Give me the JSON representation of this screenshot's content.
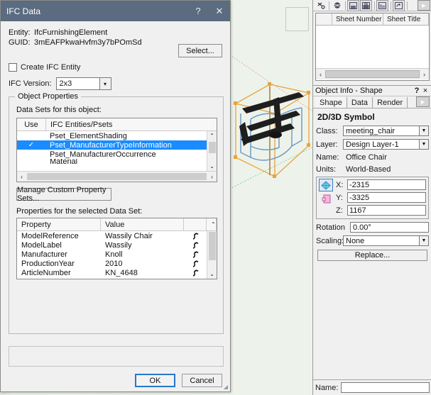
{
  "viewport": {
    "name": "3d-model-viewport",
    "model_label": "Wassily Chair 3D wireframe model"
  },
  "right_dock": {
    "toolbar": {
      "buttons": [
        {
          "name": "snap-icon",
          "glyph": "⁂"
        },
        {
          "name": "render-icon",
          "glyph": "✻"
        },
        {
          "name": "save-sheet-icon",
          "glyph": "▣"
        },
        {
          "name": "publish-icon",
          "glyph": "▤"
        },
        {
          "name": "open-folder-icon",
          "glyph": "▥"
        },
        {
          "name": "undo-icon",
          "glyph": "↶"
        }
      ],
      "overflow_glyph": "▶"
    },
    "sheet_list": {
      "columns": [
        "Sheet Number",
        "Sheet Title"
      ],
      "rows": [],
      "scroll_left_glyph": "‹",
      "scroll_right_glyph": "›"
    },
    "object_info": {
      "title": "Object Info - Shape",
      "help_glyph": "?",
      "close_glyph": "×",
      "tabs": [
        {
          "label": "Shape",
          "active": true
        },
        {
          "label": "Data",
          "active": false
        },
        {
          "label": "Render",
          "active": false
        }
      ],
      "tabs_more_glyph": "▶",
      "section_title": "2D/3D Symbol",
      "fields": {
        "class_label": "Class:",
        "class_value": "meeting_chair",
        "layer_label": "Layer:",
        "layer_value": "Design Layer-1",
        "name_label": "Name:",
        "name_value": "Office Chair",
        "units_label": "Units:",
        "units_value": "World-Based",
        "x_label": "X:",
        "x_value": "-2315",
        "y_label": "Y:",
        "y_value": "-3325",
        "z_label": "Z:",
        "z_value": "1167",
        "rotation_label": "Rotation",
        "rotation_value": "0.00°",
        "scaling_label": "Scaling:",
        "scaling_value": "None"
      },
      "coord_icons": [
        {
          "name": "3d-locus-icon",
          "selected": true,
          "color": "#2f9fd0"
        },
        {
          "name": "2d-plane-icon",
          "selected": false,
          "color": "#e06ab0"
        }
      ],
      "replace_button": "Replace...",
      "dropdown_glyph": "▼",
      "bottom": {
        "name_label": "Name:",
        "name_value": ""
      }
    }
  },
  "dialog": {
    "title": "IFC Data",
    "help_glyph": "?",
    "close_glyph": "✕",
    "entity_key": "Entity:",
    "entity_value": "IfcFurnishingElement",
    "guid_key": "GUID:",
    "guid_value": "3mEAFPkwaHvfm3y7bPOmSd",
    "select_button": "Select...",
    "create_ifc_entity_label": "Create IFC Entity",
    "create_ifc_entity_checked": false,
    "ifc_version_label": "IFC Version:",
    "ifc_version_value": "2x3",
    "group_legend": "Object Properties",
    "datasets_label": "Data Sets for this object:",
    "datasets_columns": [
      "Use",
      "IFC Entities/Psets"
    ],
    "datasets_rows": [
      {
        "use": "",
        "name": "Pset_ElementShading",
        "selected": false
      },
      {
        "use": "✓",
        "name": "Pset_ManufacturerTypeInformation",
        "selected": true
      },
      {
        "use": "",
        "name": "Pset_ManufacturerOccurrence",
        "selected": false
      },
      {
        "use": "",
        "name": "Material",
        "selected": false
      }
    ],
    "manage_button": "Manage Custom Property Sets...",
    "properties_label": "Properties for the selected Data Set:",
    "properties_columns": [
      "Property",
      "Value",
      "",
      ""
    ],
    "properties_rows": [
      {
        "property": "ModelReference",
        "value": "Wassily Chair",
        "action_icon": "link-icon"
      },
      {
        "property": "ModelLabel",
        "value": "Wassily",
        "action_icon": "link-icon"
      },
      {
        "property": "Manufacturer",
        "value": "Knoll",
        "action_icon": "link-icon"
      },
      {
        "property": "ProductionYear",
        "value": "2010",
        "action_icon": "link-icon"
      },
      {
        "property": "ArticleNumber",
        "value": "KN_4648",
        "action_icon": "link-icon"
      }
    ],
    "ok_button": "OK",
    "cancel_button": "Cancel",
    "scroll_up_glyph": "⌃",
    "scroll_down_glyph": "⌄",
    "scroll_left_glyph": "‹",
    "scroll_right_glyph": "›",
    "resize_grip_glyph": "◢"
  },
  "colors": {
    "titlebar": "#5b6b80",
    "selection": "#1a8cff",
    "dialog_bg": "#f0f0f0",
    "viewport_bg": "#eef4ec",
    "primary_button_border": "#2878c8",
    "model_orange": "#e8a33d",
    "model_blue": "#6e9bc9",
    "model_dark": "#1e1e1e",
    "axis_green": "#4fbf6a",
    "axis_red": "#e07a7a"
  }
}
